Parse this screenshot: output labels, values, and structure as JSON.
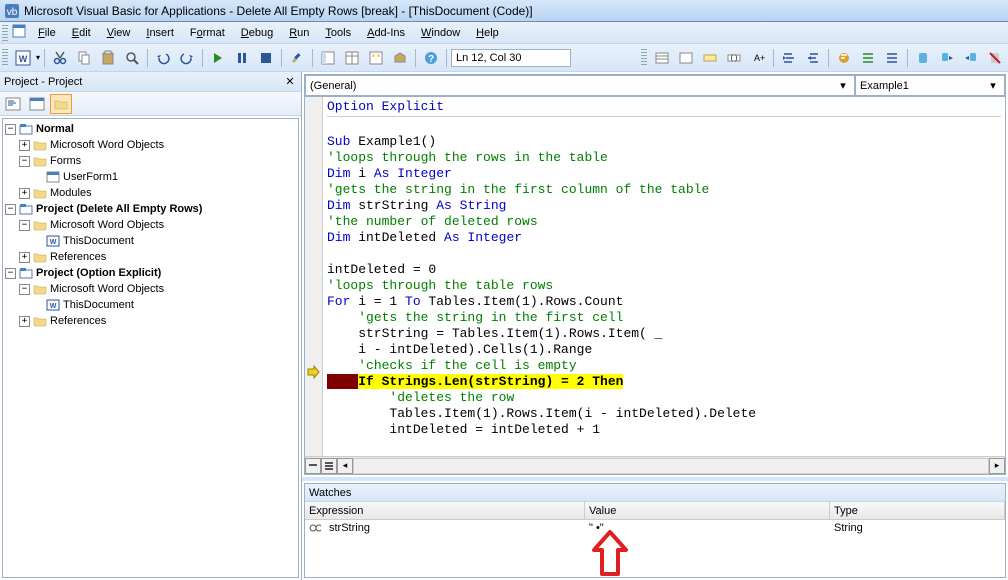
{
  "titlebar": {
    "title": "Microsoft Visual Basic for Applications - Delete All Empty Rows [break] - [ThisDocument (Code)]"
  },
  "menu": {
    "file": "File",
    "edit": "Edit",
    "view": "View",
    "insert": "Insert",
    "format": "Format",
    "debug": "Debug",
    "run": "Run",
    "tools": "Tools",
    "addins": "Add-Ins",
    "window": "Window",
    "help": "Help"
  },
  "toolbar": {
    "cursor_pos": "Ln 12, Col 30"
  },
  "project_panel": {
    "title": "Project - Project",
    "tree": {
      "normal": "Normal",
      "normal_objects": "Microsoft Word Objects",
      "normal_forms": "Forms",
      "userform1": "UserForm1",
      "normal_modules": "Modules",
      "project1": "Project (Delete All Empty Rows)",
      "project1_objects": "Microsoft Word Objects",
      "thisdocument1": "ThisDocument",
      "references1": "References",
      "project2": "Project (Option Explicit)",
      "project2_objects": "Microsoft Word Objects",
      "thisdocument2": "ThisDocument",
      "references2": "References"
    }
  },
  "code": {
    "dropdown_left": "(General)",
    "dropdown_right": "Example1",
    "lines": [
      {
        "t": "kw",
        "text": "Option Explicit"
      },
      {
        "t": "",
        "text": ""
      },
      {
        "t": "kw",
        "text": "Sub ",
        "rest": "Example1()"
      },
      {
        "t": "cm",
        "text": "'loops through the rows in the table"
      },
      {
        "t": "dim",
        "p1": "Dim",
        "v": " i ",
        "p2": "As Integer"
      },
      {
        "t": "cm",
        "text": "'gets the string in the first column of the table"
      },
      {
        "t": "dim",
        "p1": "Dim",
        "v": " strString ",
        "p2": "As String"
      },
      {
        "t": "cm",
        "text": "'the number of deleted rows"
      },
      {
        "t": "dim",
        "p1": "Dim",
        "v": " intDeleted ",
        "p2": "As Integer"
      },
      {
        "t": "",
        "text": ""
      },
      {
        "t": "",
        "text": "intDeleted = 0"
      },
      {
        "t": "cm",
        "text": "'loops through the table rows"
      },
      {
        "t": "for",
        "p1": "For",
        "v1": " i = 1 ",
        "p2": "To",
        "v2": " Tables.Item(1).Rows.Count"
      },
      {
        "t": "cm",
        "indent": "    ",
        "text": "'gets the string in the first cell"
      },
      {
        "t": "",
        "indent": "    ",
        "text": "strString = Tables.Item(1).Rows.Item( _"
      },
      {
        "t": "",
        "indent": "    ",
        "text": "i - intDeleted).Cells(1).Range"
      },
      {
        "t": "cm",
        "indent": "    ",
        "text": "'checks if the cell is empty"
      },
      {
        "t": "hl",
        "indent": "    ",
        "p1": "If",
        "v1": " Strings.Len(strString) = 2 ",
        "p2": "Then"
      },
      {
        "t": "cm",
        "indent": "        ",
        "text": "'deletes the row"
      },
      {
        "t": "",
        "indent": "        ",
        "text": "Tables.Item(1).Rows.Item(i - intDeleted).Delete"
      },
      {
        "t": "",
        "indent": "        ",
        "text": "intDeleted = intDeleted + 1"
      }
    ]
  },
  "watches": {
    "title": "Watches",
    "col_expr": "Expression",
    "col_value": "Value",
    "col_type": "Type",
    "row_expr": "strString",
    "row_value": "\" •\"",
    "row_type": "String"
  }
}
